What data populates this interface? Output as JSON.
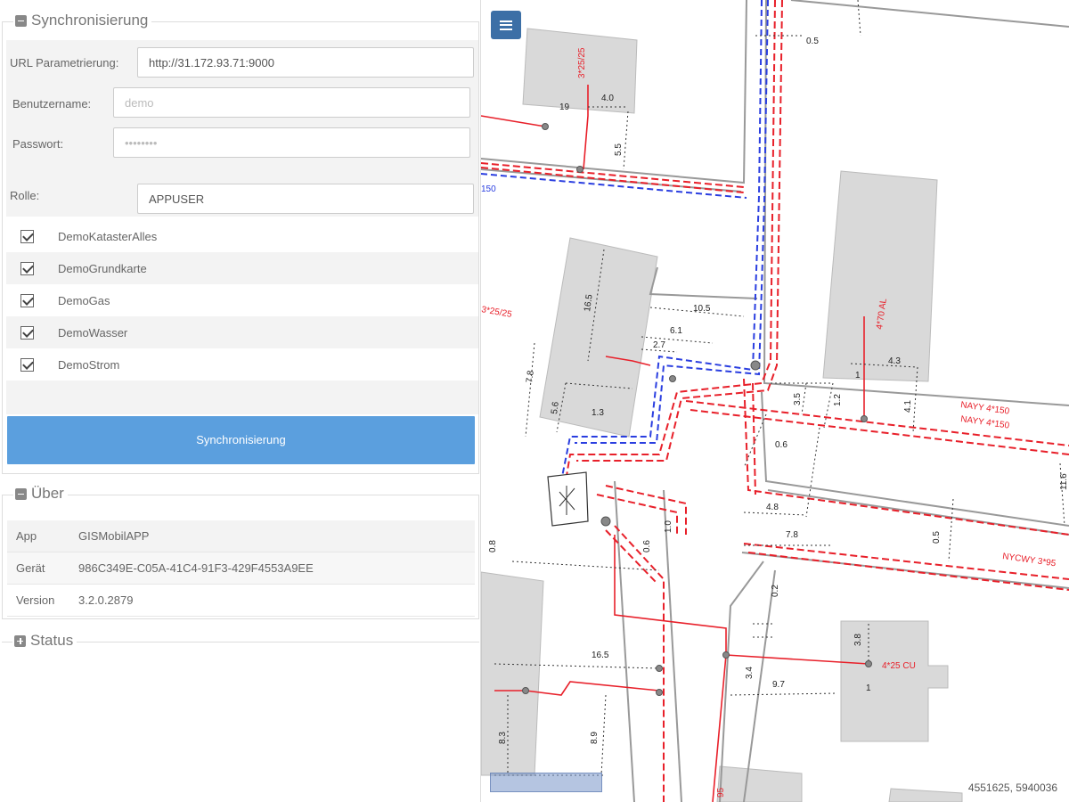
{
  "sync": {
    "title": "Synchronisierung",
    "url_label": "URL Parametrierung:",
    "url_value": "http://31.172.93.71:9000",
    "user_label": "Benutzername:",
    "user_placeholder": "demo",
    "pass_label": "Passwort:",
    "pass_placeholder": "••••••••",
    "role_label": "Rolle:",
    "role_value": "APPUSER",
    "layers": [
      "DemoKatasterAlles",
      "DemoGrundkarte",
      "DemoGas",
      "DemoWasser",
      "DemoStrom"
    ],
    "button": "Synchronisierung"
  },
  "about": {
    "title": "Über",
    "rows": [
      {
        "key": "App",
        "value": "GISMobilAPP"
      },
      {
        "key": "Gerät",
        "value": "986C349E-C05A-41C4-91F3-429F4553A9EE"
      },
      {
        "key": "Version",
        "value": "3.2.0.2879"
      }
    ]
  },
  "status": {
    "title": "Status"
  },
  "map": {
    "coordinates": "4551625, 5940036",
    "labels": {
      "l1": "0.5",
      "l2": "3*25/25",
      "l3": "4.0",
      "l4": "19",
      "l5": "5.5",
      "l6": "150",
      "l7": "3*25/25",
      "l8": "16.5",
      "l9": "10.5",
      "l10": "6.1",
      "l11": "2.7",
      "l12": "7.8",
      "l13": "5.6",
      "l14": "1.3",
      "l15": "4*70 AL",
      "l16": "4.3",
      "l17": "1",
      "l18": "3.5",
      "l19": "1.2",
      "l20": "4.1",
      "l21": "NAYY 4*150",
      "l22": "NAYY 4*150",
      "l23": "0.6",
      "l24": "4.8",
      "l25": "7.8",
      "l26": "0.5",
      "l27": "11.6",
      "l28": "NYCWY 3*95",
      "l29": "0.8",
      "l30": "1.0",
      "l31": "0.6",
      "l32": "0.2",
      "l33": "3.8",
      "l34": "4*25 CU",
      "l35": "16.5",
      "l36": "3.4",
      "l37": "9.7",
      "l38": "1",
      "l39": "8.3",
      "l40": "8.9",
      "l41": "95"
    }
  },
  "colors": {
    "accent": "#5b9fde",
    "menu": "#3c6fa6",
    "electric": "#e8202a",
    "water": "#2a3ee0"
  }
}
